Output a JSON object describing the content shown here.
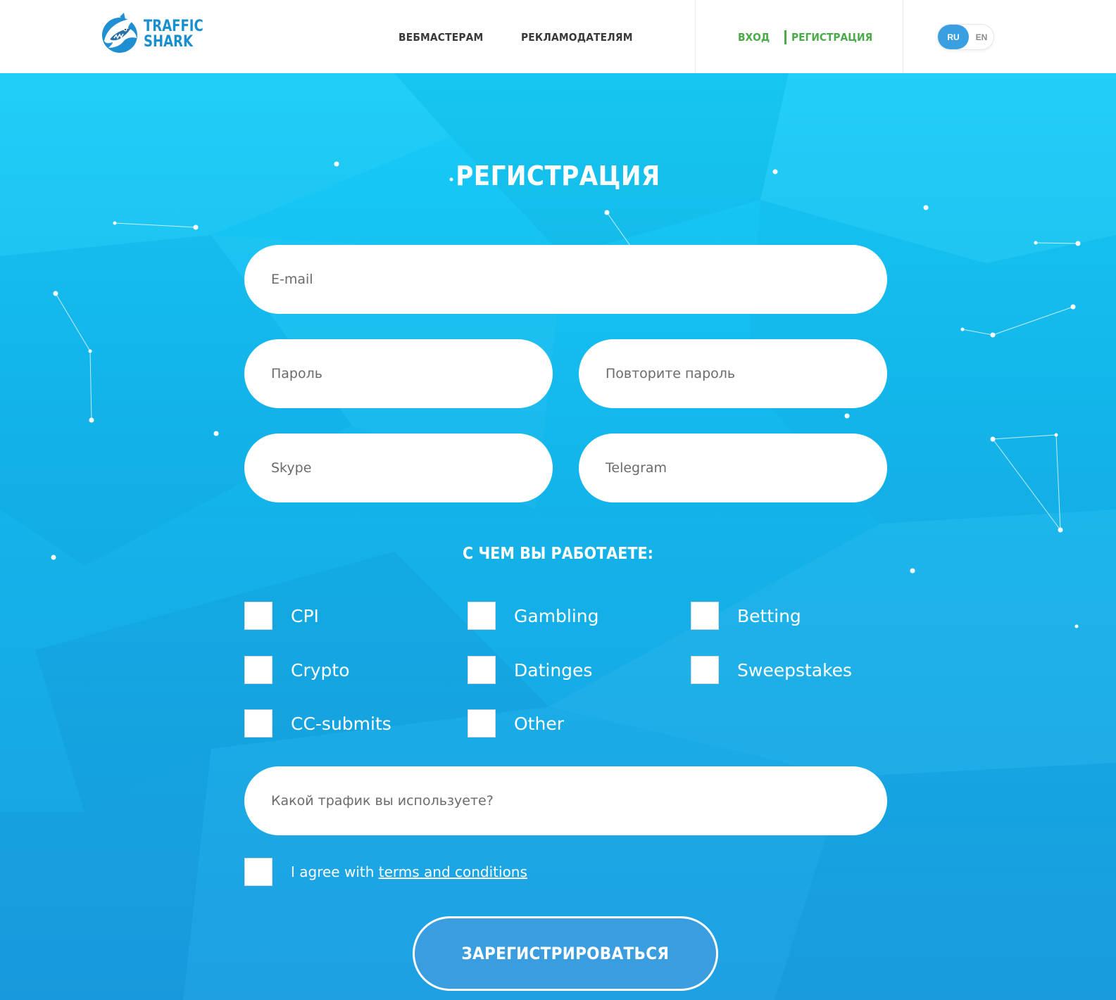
{
  "header": {
    "logo_line1": "TRAFFIC",
    "logo_line2": "SHARK",
    "nav": [
      {
        "label": "ВЕБМАСТЕРАМ"
      },
      {
        "label": "РЕКЛАМОДАТЕЛЯМ"
      }
    ],
    "login_label": "ВХОД",
    "register_label": "РЕГИСТРАЦИЯ",
    "lang_active": "RU",
    "lang_other": "EN"
  },
  "form": {
    "title": "РЕГИСТРАЦИЯ",
    "email_placeholder": "E-mail",
    "password_placeholder": "Пароль",
    "password_repeat_placeholder": "Повторите пароль",
    "skype_placeholder": "Skype",
    "telegram_placeholder": "Telegram",
    "work_title": "С ЧЕМ ВЫ РАБОТАЕТЕ:",
    "categories": [
      "CPI",
      "Gambling",
      "Betting",
      "Crypto",
      "Datinges",
      "Sweepstakes",
      "CC-submits",
      "Other"
    ],
    "traffic_placeholder": "Какой трафик вы используете?",
    "agree_prefix": "I agree with ",
    "agree_link": "terms and conditions",
    "submit_label": "ЗАРЕГИСТРИРОВАТЬСЯ"
  },
  "colors": {
    "accent_blue": "#3a9fe0",
    "auth_green": "#4bab4b",
    "logo_blue": "#1a8fd0",
    "hero_top": "#17cdf8",
    "hero_bottom": "#1a9fe2"
  }
}
